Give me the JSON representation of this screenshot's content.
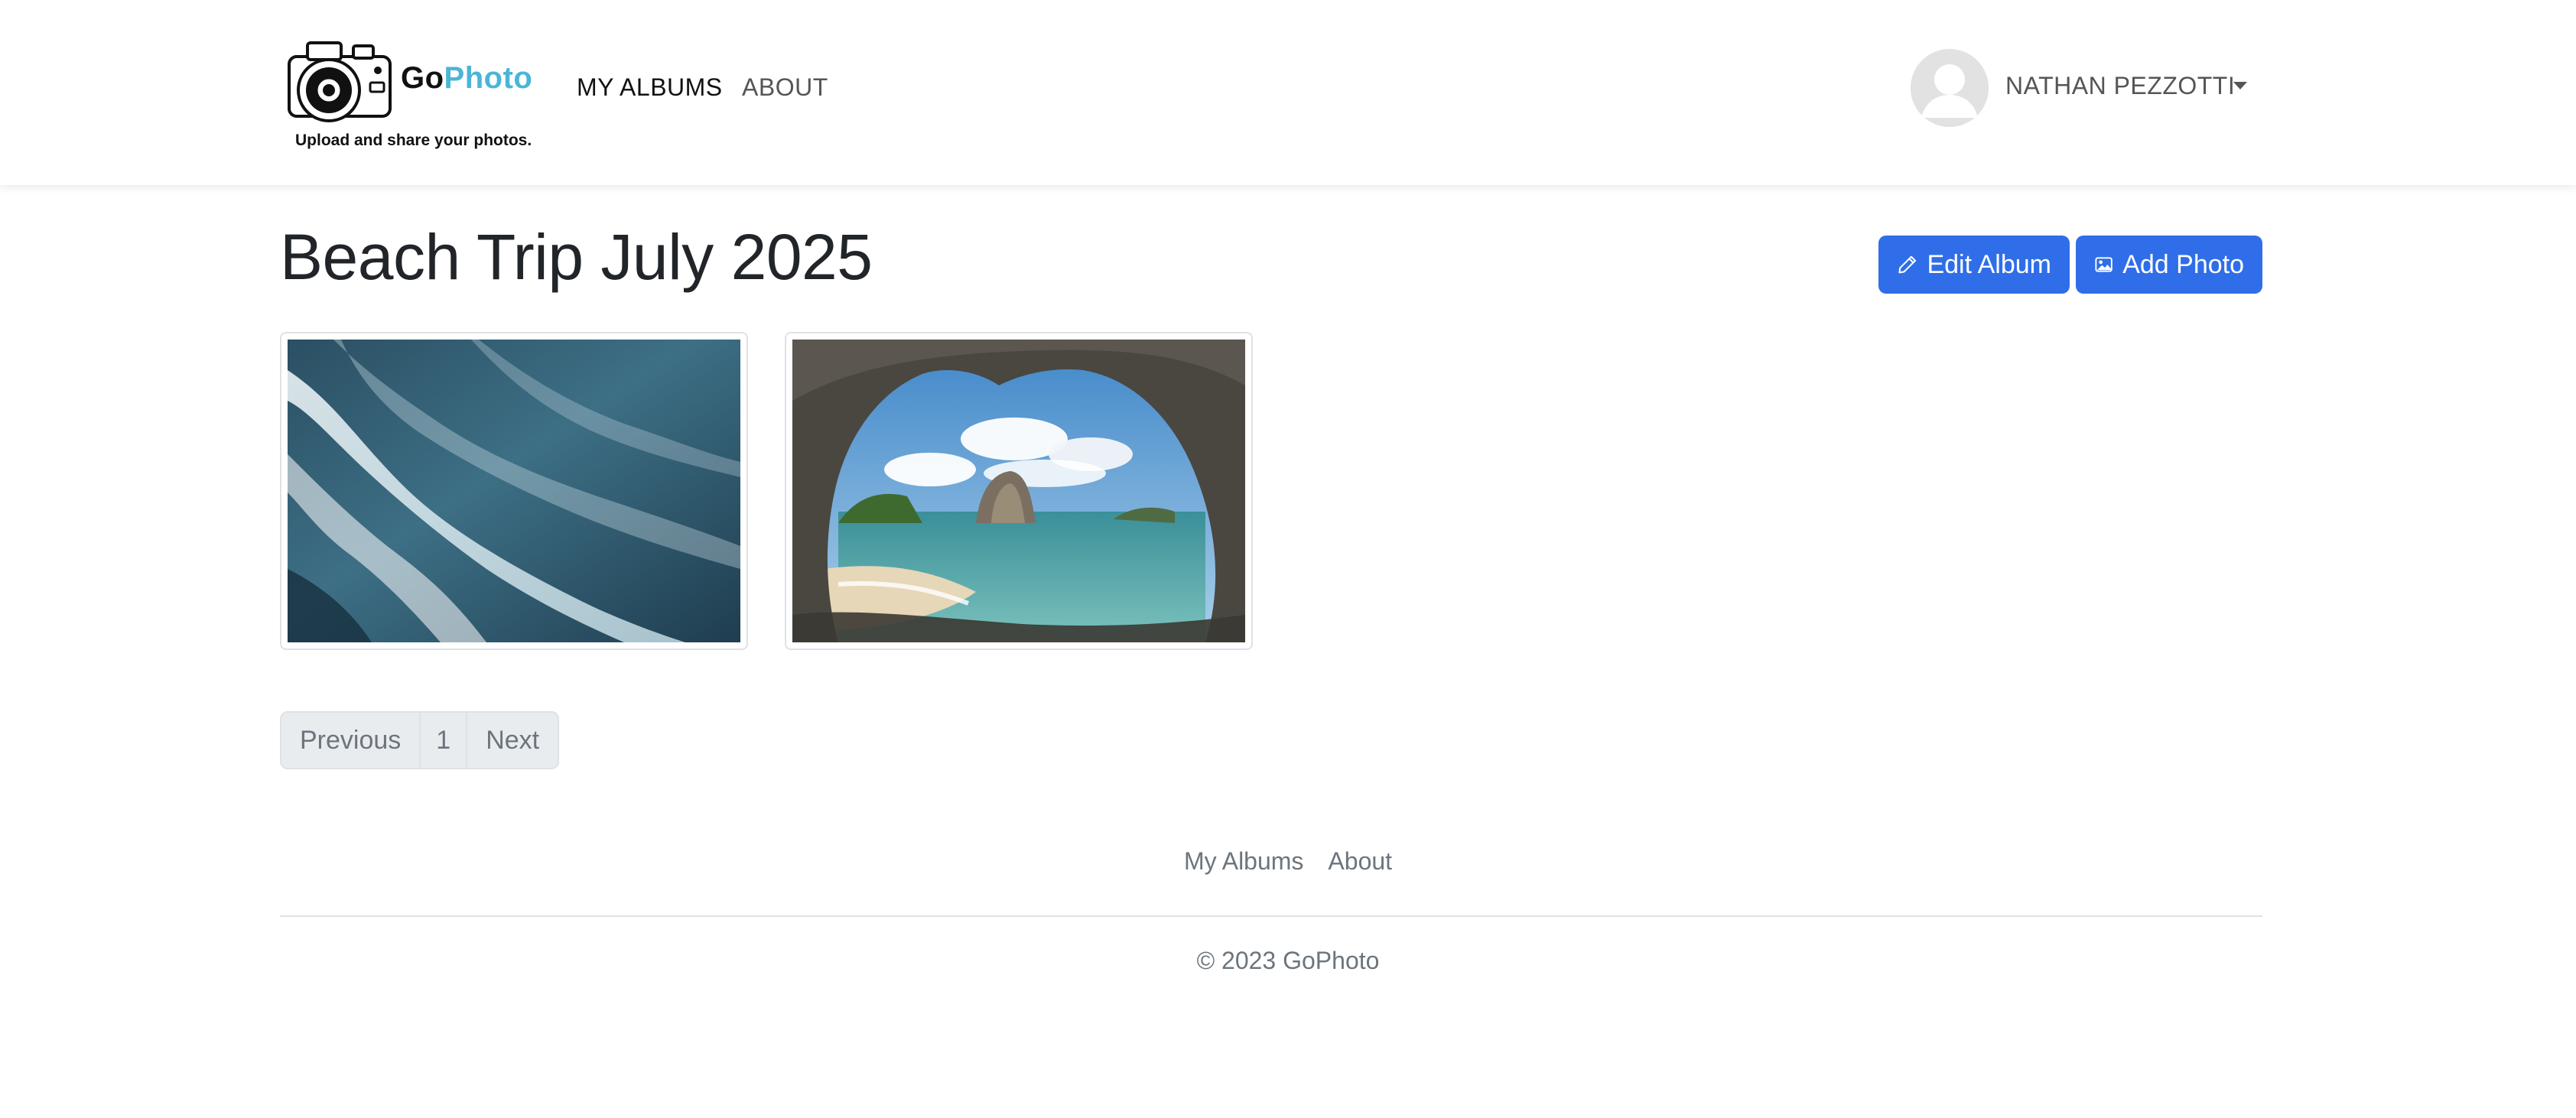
{
  "header": {
    "brand_go": "Go",
    "brand_photo": "Photo",
    "tagline": "Upload and share your photos.",
    "nav": {
      "my_albums": "MY ALBUMS",
      "about": "ABOUT"
    },
    "user_name": "NATHAN PEZZOTTI",
    "brand_accent_color": "#4ab6d6"
  },
  "main": {
    "album_title": "Beach Trip July 2025",
    "edit_button": "Edit Album",
    "add_button": "Add Photo",
    "button_color": "#2f6ee8",
    "photos": [
      {
        "icon": "ocean-waves-photo"
      },
      {
        "icon": "sea-cave-beach-photo"
      }
    ],
    "pagination": {
      "previous": "Previous",
      "current": "1",
      "next": "Next"
    }
  },
  "footer": {
    "links": {
      "my_albums": "My Albums",
      "about": "About"
    },
    "copyright": "© 2023 GoPhoto"
  }
}
